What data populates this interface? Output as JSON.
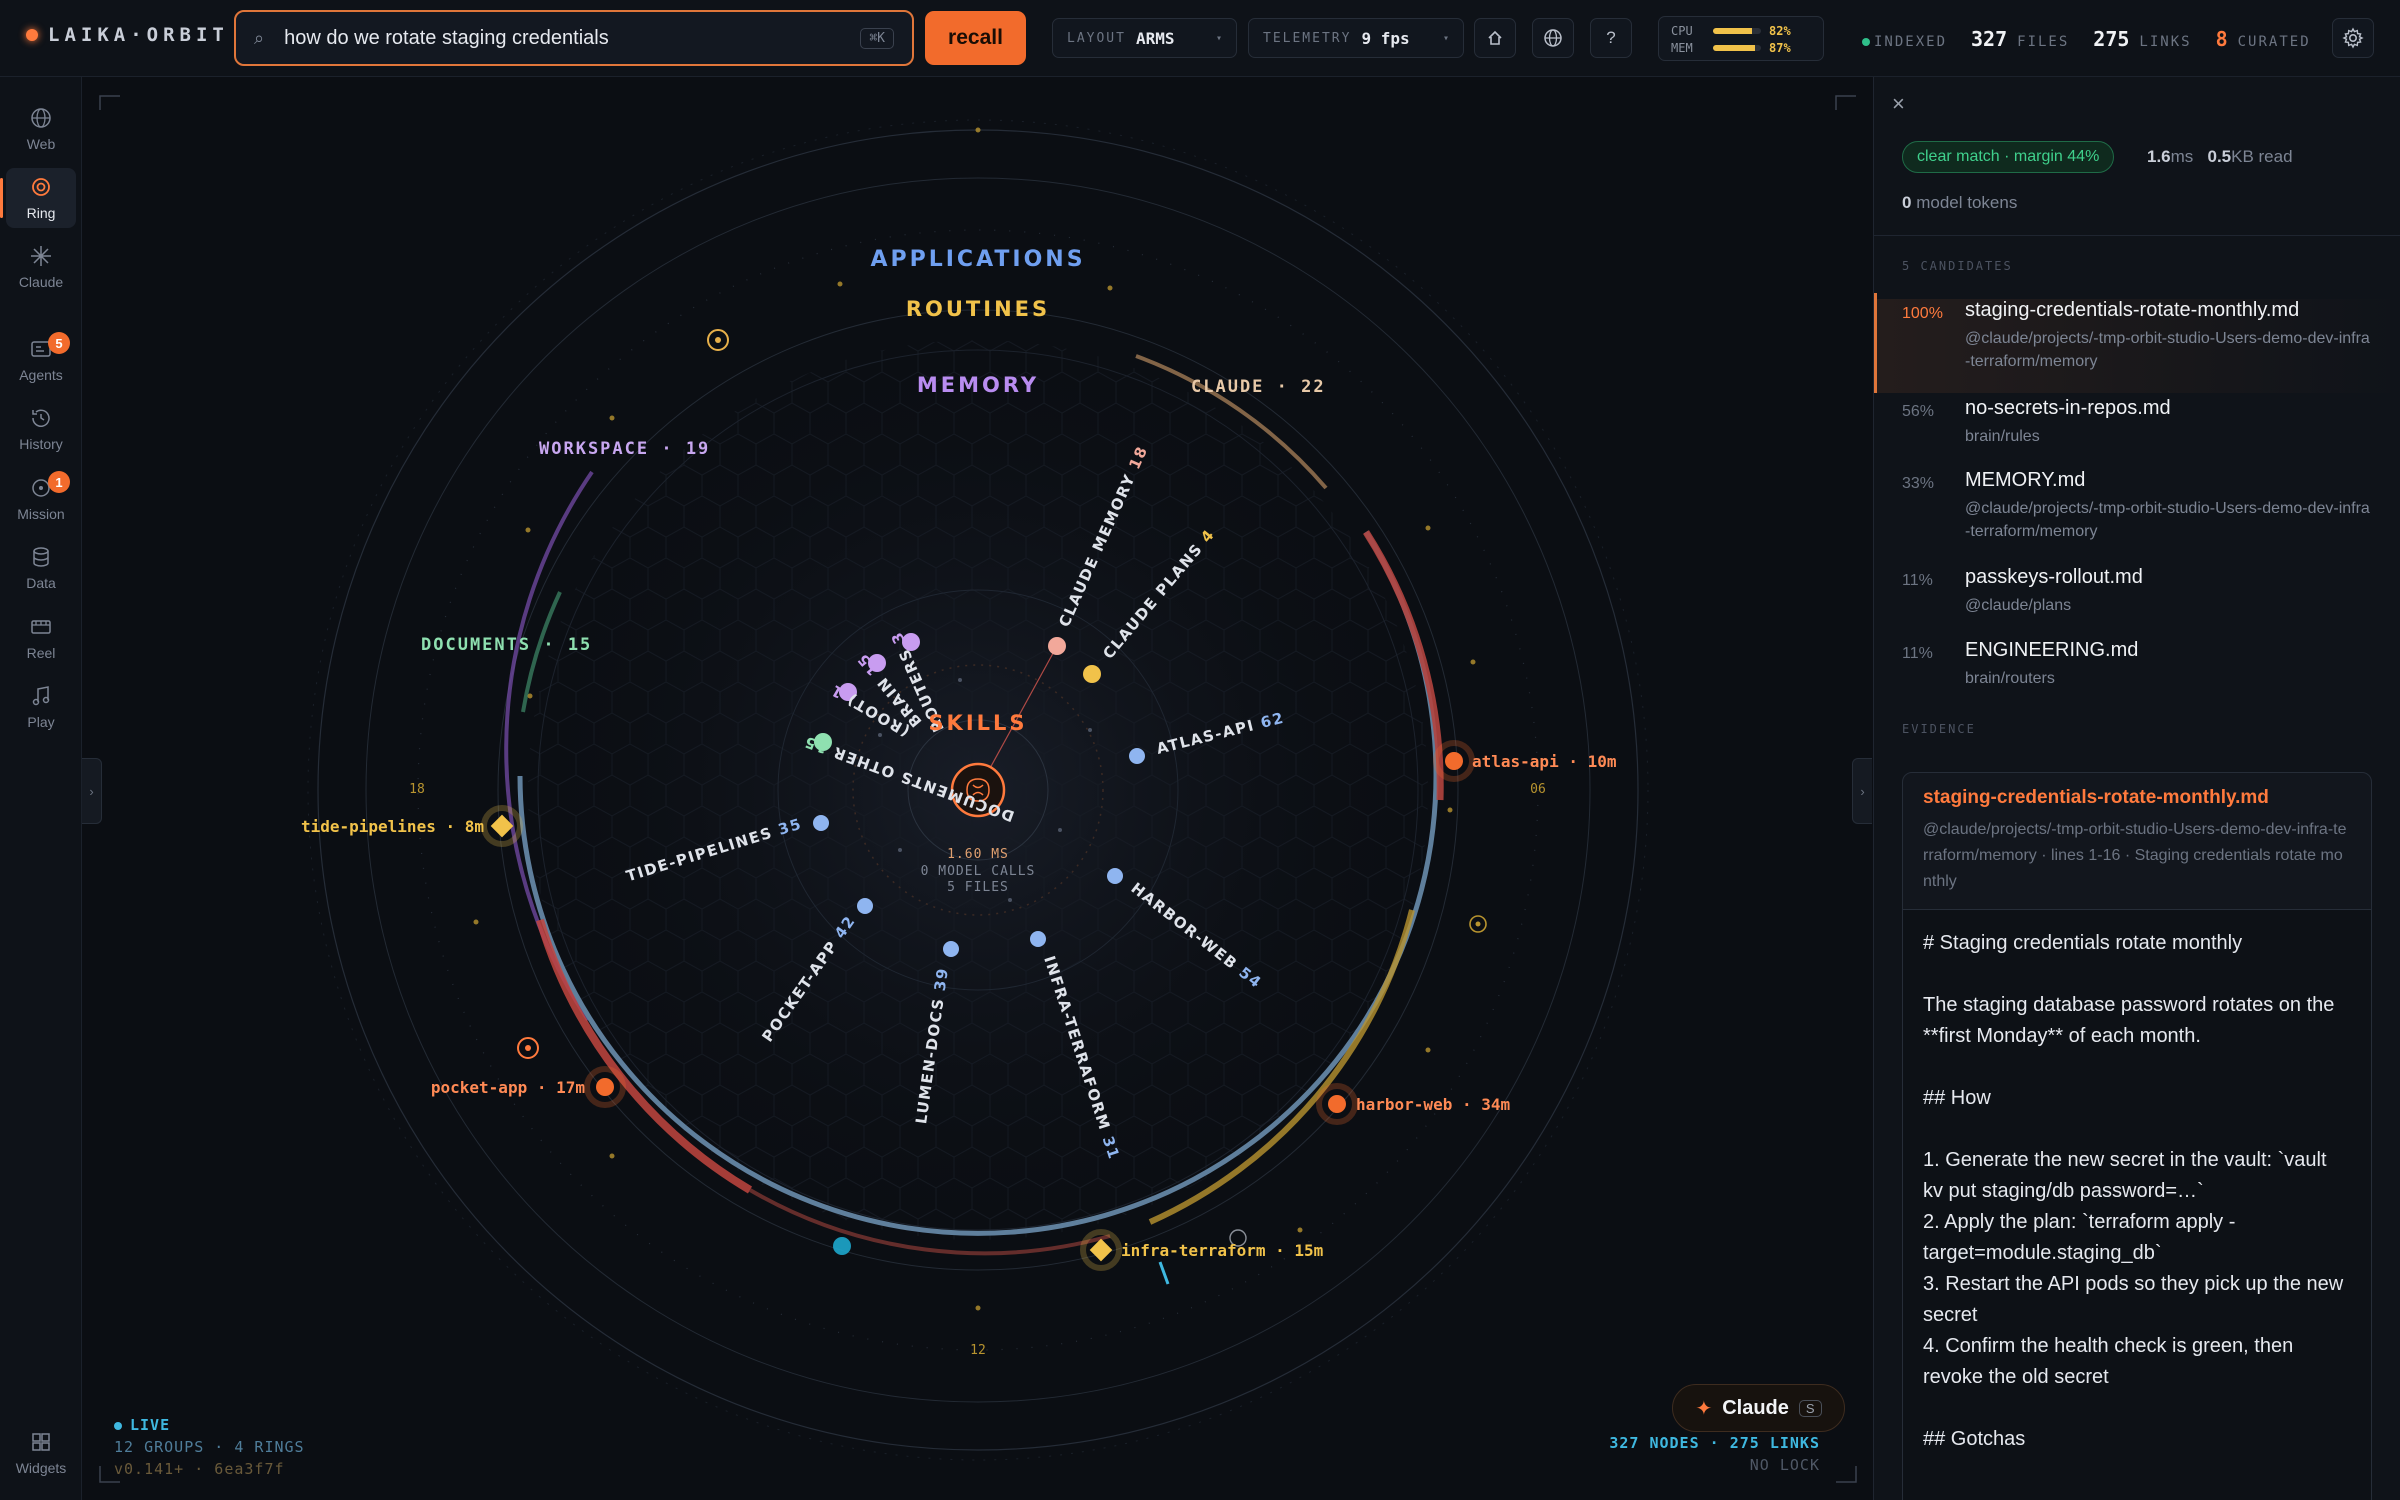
{
  "app": {
    "brand": "LAIKA·ORBIT"
  },
  "search": {
    "query": "how do we rotate staging credentials",
    "shortcut": "⌘K",
    "button": "recall"
  },
  "toolbar": {
    "layout_label": "LAYOUT",
    "layout_value": "ARMS",
    "telemetry_label": "TELEMETRY",
    "telemetry_value": "9 fps",
    "home_icon": "home-icon",
    "globe_icon": "globe-icon",
    "help_label": "?"
  },
  "system": {
    "cpu_label": "CPU",
    "cpu_pct": "82%",
    "cpu_value": 0.82,
    "mem_label": "MEM",
    "mem_pct": "87%",
    "mem_value": 0.87,
    "bar_color": "#f1c24a"
  },
  "index": {
    "status": "INDEXED",
    "files": "327",
    "files_label": "FILES",
    "links": "275",
    "links_label": "LINKS",
    "curated": "8",
    "curated_label": "CURATED"
  },
  "sidebar": {
    "items": [
      {
        "label": "Web",
        "icon": "globe-icon"
      },
      {
        "label": "Ring",
        "icon": "ring-icon",
        "active": true
      },
      {
        "label": "Claude",
        "icon": "sparkle-icon"
      },
      {
        "label": "Agents",
        "icon": "agents-icon",
        "badge": "5"
      },
      {
        "label": "History",
        "icon": "history-icon"
      },
      {
        "label": "Mission",
        "icon": "mission-icon",
        "badge": "1"
      },
      {
        "label": "Data",
        "icon": "database-icon"
      },
      {
        "label": "Reel",
        "icon": "film-icon"
      },
      {
        "label": "Play",
        "icon": "music-icon"
      }
    ],
    "widgets_label": "Widgets"
  },
  "ring": {
    "rings": [
      "APPLICATIONS",
      "ROUTINES",
      "MEMORY"
    ],
    "core": {
      "label": "SKILLS",
      "ms": "1.60 MS",
      "calls": "0 MODEL CALLS",
      "files": "5 FILES"
    },
    "groups": [
      {
        "name": "WORKSPACE · 19"
      },
      {
        "name": "CLAUDE · 22"
      },
      {
        "name": "DOCUMENTS · 15"
      }
    ],
    "spokes": [
      {
        "label": "ROUTERS",
        "count": "3"
      },
      {
        "label": "BRAIN",
        "count": "15"
      },
      {
        "label": "(ROOT)",
        "count": "1"
      },
      {
        "label": "DOCUMENTS OTHER",
        "count": "15"
      },
      {
        "label": "TIDE-PIPELINES",
        "count": "35"
      },
      {
        "label": "POCKET-APP",
        "count": "42"
      },
      {
        "label": "LUMEN-DOCS",
        "count": "39"
      },
      {
        "label": "INFRA-TERRAFORM",
        "count": "31"
      },
      {
        "label": "HARBOR-WEB",
        "count": "54"
      },
      {
        "label": "ATLAS-API",
        "count": "62"
      },
      {
        "label": "CLAUDE PLANS",
        "count": "4"
      },
      {
        "label": "CLAUDE MEMORY",
        "count": "18"
      }
    ],
    "satellites": [
      {
        "label": "atlas-api · 10m"
      },
      {
        "label": "tide-pipelines · 8m"
      },
      {
        "label": "pocket-app · 17m"
      },
      {
        "label": "harbor-web · 34m"
      },
      {
        "label": "infra-terraform · 15m"
      }
    ],
    "ticks": [
      "18",
      "06",
      "12"
    ],
    "colors": {
      "accent": "#ff7a3d",
      "memory": "#b98cf0",
      "applications": "#6f9ff0",
      "routines": "#f1c24a",
      "documents": "#7fe0b0"
    }
  },
  "hud": {
    "live": "LIVE",
    "groups": "12 GROUPS · 4 RINGS",
    "version": "v0.141+ · 6ea3f7f",
    "nodes": "327 NODES · 275 LINKS",
    "lock": "NO LOCK"
  },
  "claude_button": {
    "label": "Claude",
    "shortcut": "S"
  },
  "panel": {
    "match": "clear match · margin 44%",
    "time_value": "1.6",
    "time_unit": "ms",
    "read_value": "0.5",
    "read_unit": "KB read",
    "tokens_value": "0",
    "tokens_label": "model tokens",
    "candidates_header": "5 CANDIDATES",
    "candidates": [
      {
        "pct": "100%",
        "name": "staging-credentials-rotate-monthly.md",
        "path": "@claude/projects/-tmp-orbit-studio-Users-demo-dev-infra-terraform/memory"
      },
      {
        "pct": "56%",
        "name": "no-secrets-in-repos.md",
        "path": "brain/rules"
      },
      {
        "pct": "33%",
        "name": "MEMORY.md",
        "path": "@claude/projects/-tmp-orbit-studio-Users-demo-dev-infra-terraform/memory"
      },
      {
        "pct": "11%",
        "name": "passkeys-rollout.md",
        "path": "@claude/plans"
      },
      {
        "pct": "11%",
        "name": "ENGINEERING.md",
        "path": "brain/routers"
      }
    ],
    "evidence_header": "EVIDENCE",
    "evidence": {
      "title": "staging-credentials-rotate-monthly.md",
      "meta": "@claude/projects/-tmp-orbit-studio-Users-demo-dev-infra-terraform/memory · lines 1-16 · Staging credentials rotate monthly",
      "lines": [
        "# Staging credentials rotate monthly",
        "The staging database password rotates on the **first Monday** of each month.",
        "## How",
        "1. Generate the new secret in the vault: `vault kv put staging/db password=…`\n2. Apply the plan: `terraform apply -target=module.staging_db`\n3. Restart the API pods so they pick up the new secret\n4. Confirm the health check is green, then revoke the old secret",
        "## Gotchas"
      ]
    }
  }
}
